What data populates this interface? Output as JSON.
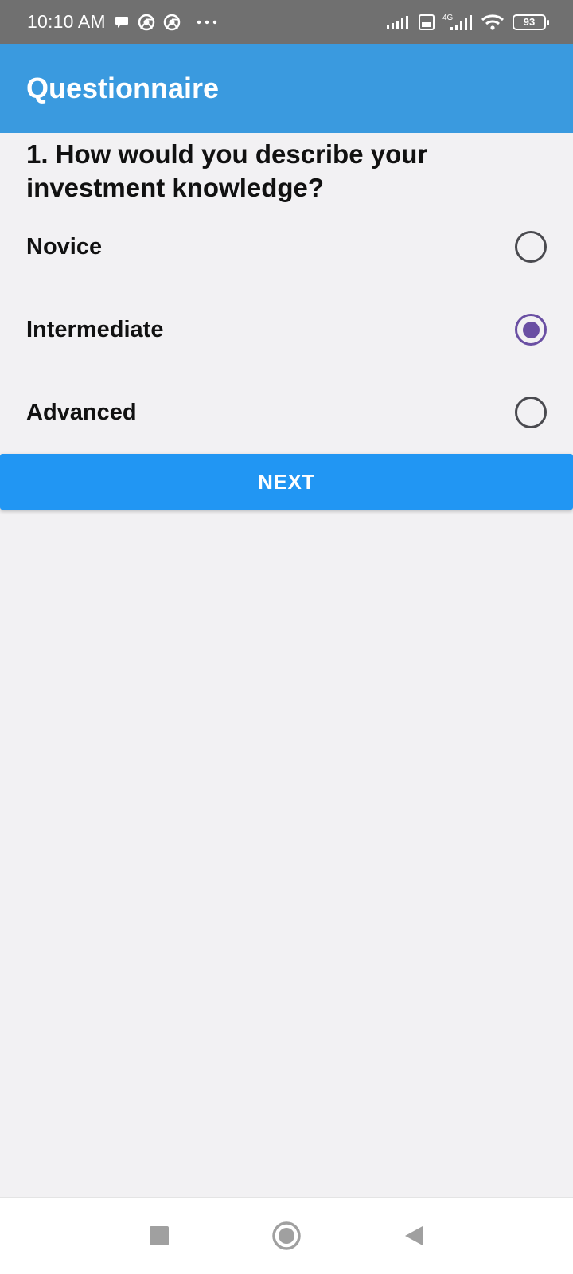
{
  "status_bar": {
    "time": "10:10 AM",
    "notification_icons": [
      "chat-bubble-icon",
      "chrome-icon",
      "chrome-icon",
      "more-dots-icon"
    ],
    "system_icons": [
      "signal-icon",
      "volte-icon",
      "4g-signal-icon",
      "wifi-icon"
    ],
    "battery": "93"
  },
  "app_bar": {
    "title": "Questionnaire",
    "color": "#3a9adf"
  },
  "question": {
    "text": "1. How would you describe your investment knowledge?",
    "options": [
      {
        "label": "Novice",
        "selected": false
      },
      {
        "label": "Intermediate",
        "selected": true
      },
      {
        "label": "Advanced",
        "selected": false
      }
    ]
  },
  "next_button": {
    "label": "NEXT",
    "color": "#2196f3"
  },
  "nav_bar": {
    "icons": [
      "recents-square-icon",
      "home-circle-icon",
      "back-triangle-icon"
    ]
  },
  "colors": {
    "radio_selected": "#6a4fa3",
    "background": "#f2f1f3"
  }
}
